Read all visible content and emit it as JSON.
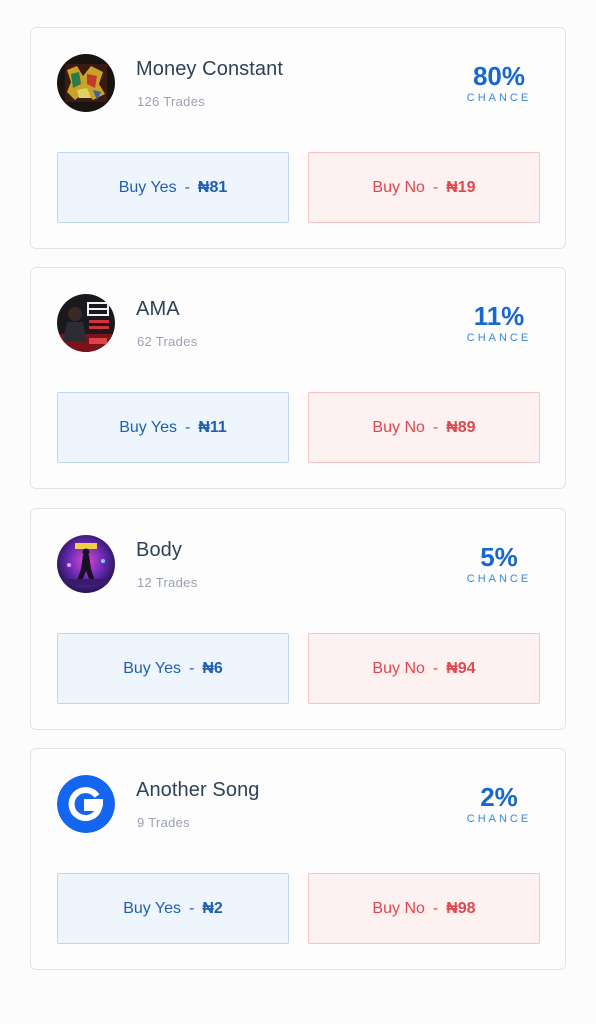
{
  "markets": [
    {
      "title": "Money Constant",
      "trades": "126 Trades",
      "chance": "80%",
      "chance_label": "CHANCE",
      "yes_label": "Buy Yes",
      "yes_sep": "-",
      "yes_price": "₦81",
      "no_label": "Buy No",
      "no_sep": "-",
      "no_price": "₦19",
      "avatar": "album-art-money-constant"
    },
    {
      "title": "AMA",
      "trades": "62 Trades",
      "chance": "11%",
      "chance_label": "CHANCE",
      "yes_label": "Buy Yes",
      "yes_sep": "-",
      "yes_price": "₦11",
      "no_label": "Buy No",
      "no_sep": "-",
      "no_price": "₦89",
      "avatar": "album-art-ama"
    },
    {
      "title": "Body",
      "trades": "12 Trades",
      "chance": "5%",
      "chance_label": "CHANCE",
      "yes_label": "Buy Yes",
      "yes_sep": "-",
      "yes_price": "₦6",
      "no_label": "Buy No",
      "no_sep": "-",
      "no_price": "₦94",
      "avatar": "album-art-body"
    },
    {
      "title": "Another Song",
      "trades": "9 Trades",
      "chance": "2%",
      "chance_label": "CHANCE",
      "yes_label": "Buy Yes",
      "yes_sep": "-",
      "yes_price": "₦2",
      "no_label": "Buy No",
      "no_sep": "-",
      "no_price": "₦98",
      "avatar": "brand-logo-icon"
    }
  ],
  "colors": {
    "accent": "#1668cf",
    "yes_bg": "#eef5fd",
    "no_bg": "#fef1f1",
    "no_text": "#e0474e"
  }
}
